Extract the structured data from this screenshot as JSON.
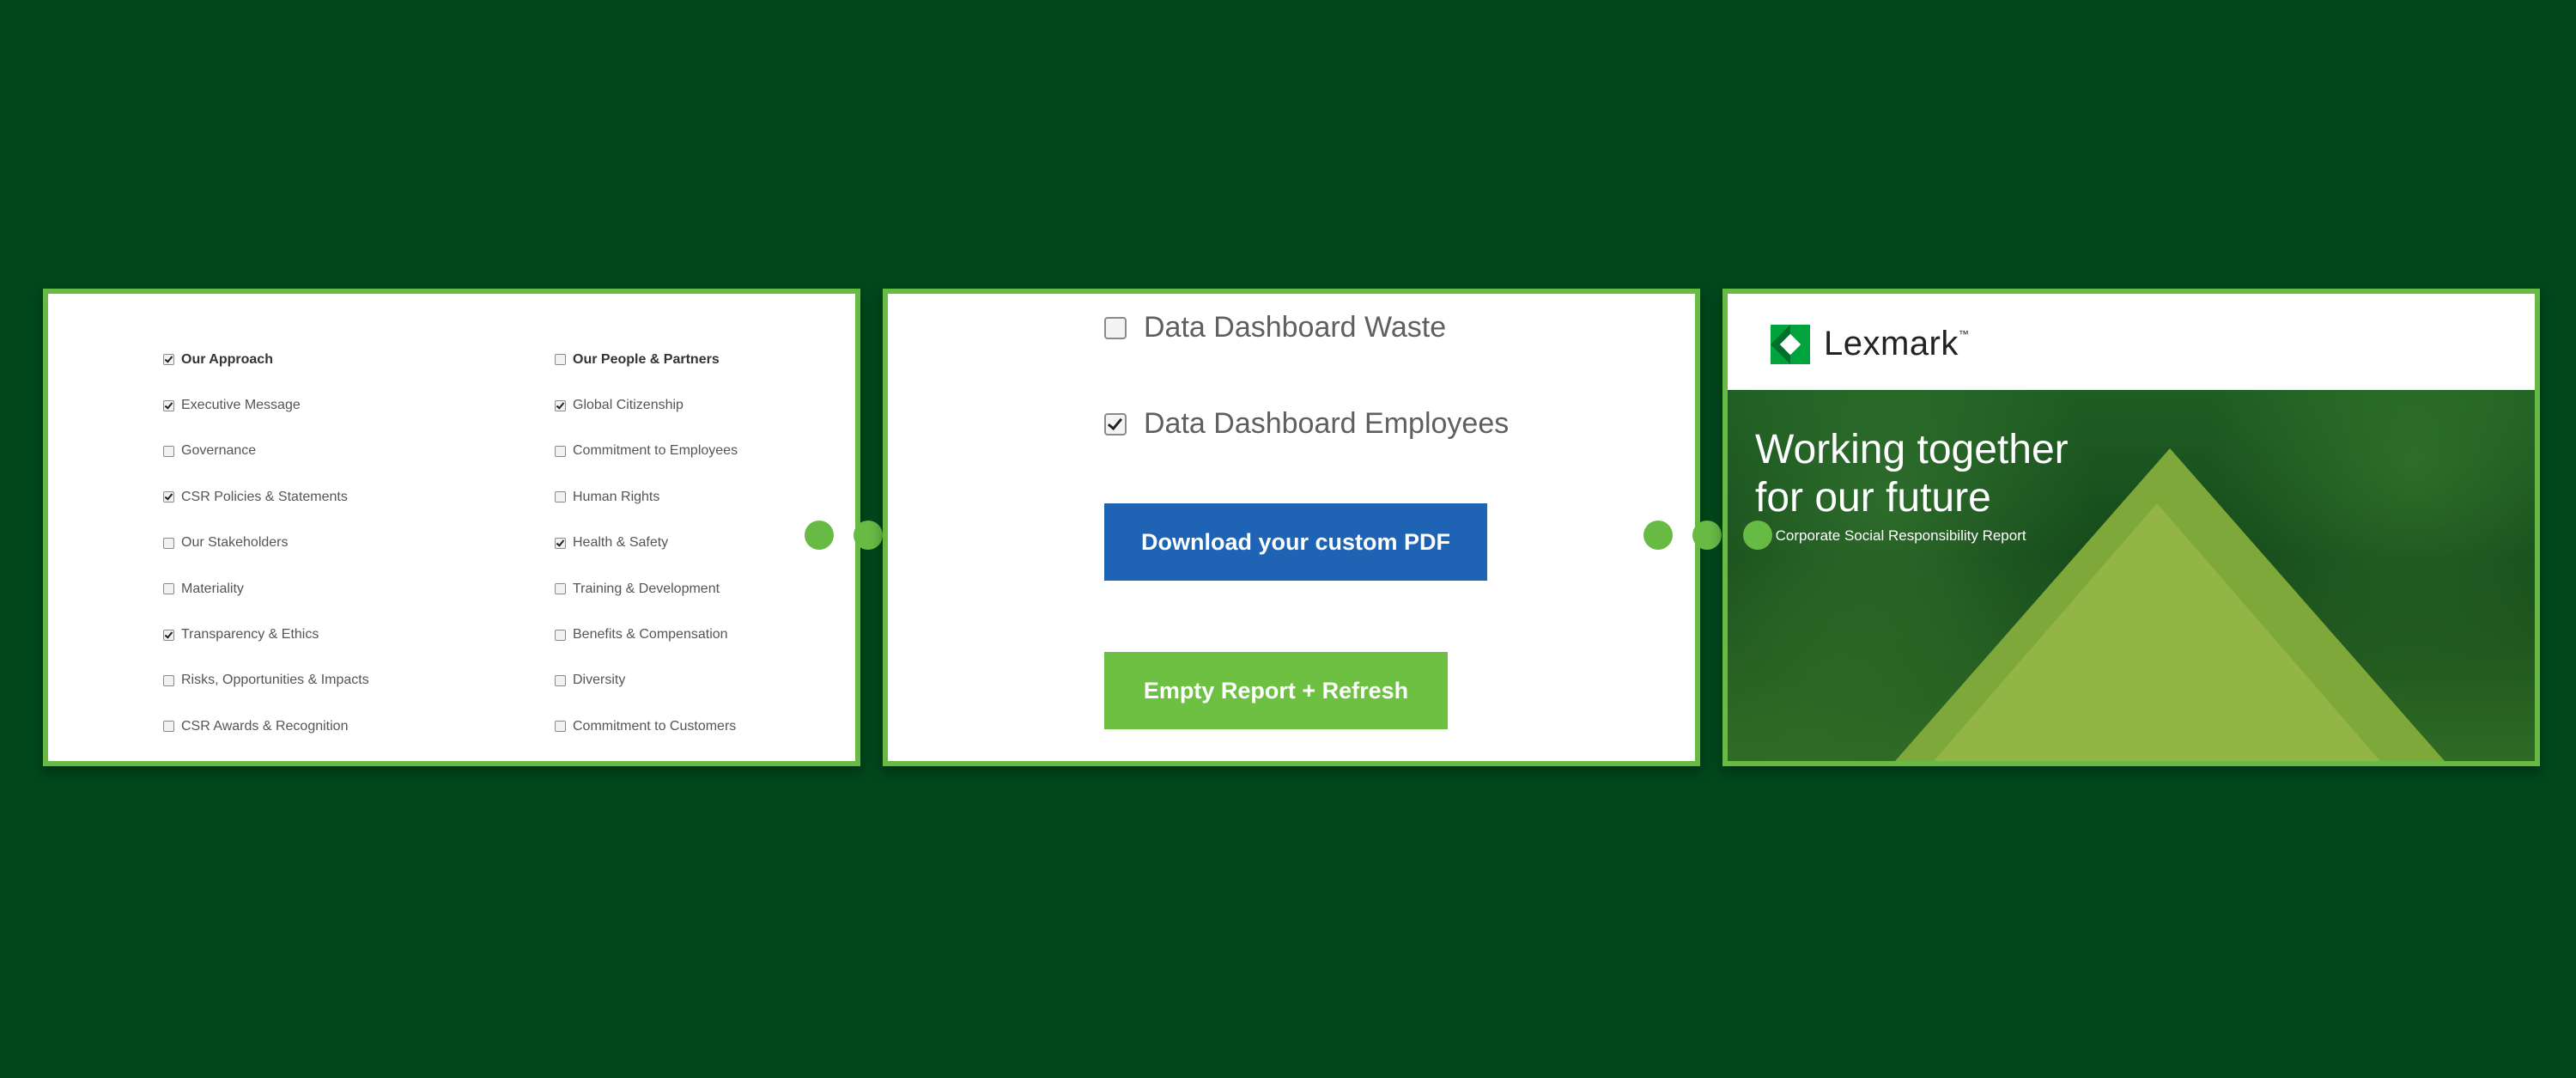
{
  "checklist": {
    "col_a": [
      {
        "label": "Our Approach",
        "checked": true,
        "head": true
      },
      {
        "label": "Executive Message",
        "checked": true
      },
      {
        "label": "Governance",
        "checked": false
      },
      {
        "label": "CSR Policies & Statements",
        "checked": true
      },
      {
        "label": "Our Stakeholders",
        "checked": false
      },
      {
        "label": "Materiality",
        "checked": false
      },
      {
        "label": "Transparency & Ethics",
        "checked": true
      },
      {
        "label": "Risks, Opportunities & Impacts",
        "checked": false
      },
      {
        "label": "CSR Awards & Recognition",
        "checked": false
      }
    ],
    "col_b": [
      {
        "label": "Our People & Partners",
        "checked": false,
        "head": true
      },
      {
        "label": "Global Citizenship",
        "checked": true
      },
      {
        "label": "Commitment to Employees",
        "checked": false
      },
      {
        "label": "Human Rights",
        "checked": false
      },
      {
        "label": "Health & Safety",
        "checked": true
      },
      {
        "label": "Training & Development",
        "checked": false
      },
      {
        "label": "Benefits & Compensation",
        "checked": false
      },
      {
        "label": "Diversity",
        "checked": false
      },
      {
        "label": "Commitment to Customers",
        "checked": false
      }
    ]
  },
  "dashboard": {
    "waste_label": "Data Dashboard Waste",
    "waste_checked": false,
    "employees_label": "Data Dashboard Employees",
    "employees_checked": true
  },
  "actions": {
    "download_label": "Download your custom PDF",
    "empty_label": "Empty Report + Refresh"
  },
  "cover": {
    "brand": "Lexmark",
    "trademark": "™",
    "title_line1": "Working together",
    "title_line2": "for our future",
    "subtitle": "17 Corporate Social Responsibility Report"
  },
  "colors": {
    "background": "#00471c",
    "accent_green": "#67bb45",
    "download_blue": "#1e63b4",
    "empty_green": "#6ec043"
  }
}
